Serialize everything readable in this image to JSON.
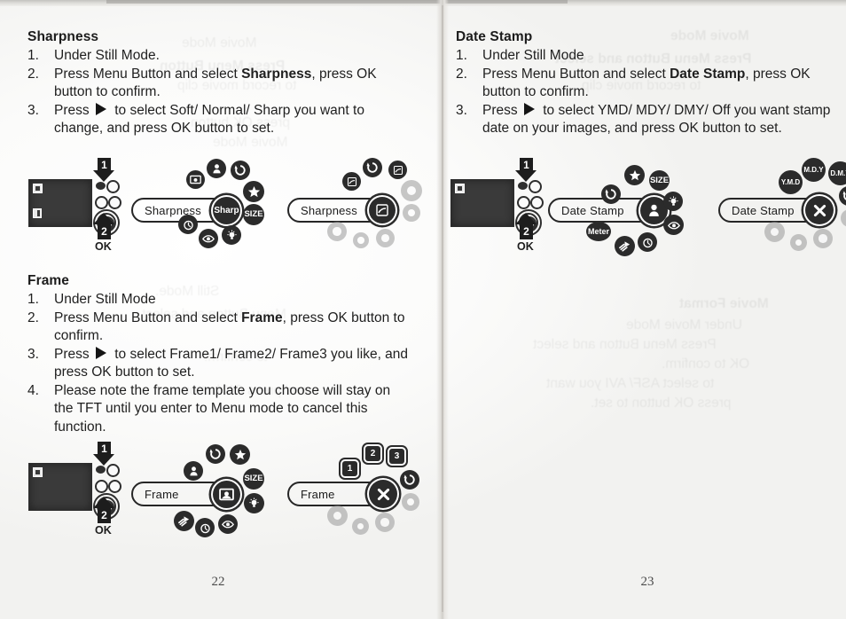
{
  "document": {
    "type": "camera-user-manual-spread",
    "scan_note": "two-page scanned spread with binding gutter and reverse-side show-through"
  },
  "left_page": {
    "page_number": "22",
    "sections": [
      {
        "id": "sharpness",
        "title": "Sharpness",
        "steps": [
          {
            "num": "1.",
            "parts": [
              {
                "t": "Under Still Mode."
              }
            ]
          },
          {
            "num": "2.",
            "parts": [
              {
                "t": "Press Menu Button and select "
              },
              {
                "t": "Sharpness",
                "bold": true
              },
              {
                "t": ", press OK button to confirm."
              }
            ]
          },
          {
            "num": "3.",
            "parts": [
              {
                "t": "Press "
              },
              {
                "t": "",
                "icon": "right-arrow"
              },
              {
                "t": " to select Soft/ Normal/ Sharp you want to change, and press OK button to set."
              }
            ]
          }
        ],
        "diagram": {
          "camera": {
            "shutter_callout": "1",
            "ok_callout": "2",
            "ok_label": "OK"
          },
          "menu_cluster": {
            "pill_label": "Sharpness",
            "selected_node": "Sharp",
            "orbit_icons": [
              "frame-icon",
              "stamp-icon",
              "rotate-icon",
              "star-icon",
              "size-icon",
              "lightbulb-icon",
              "redeye-icon",
              "timer-icon"
            ]
          },
          "value_cluster": {
            "pill_label": "Sharpness",
            "selected_node": "sharp-level-icon",
            "orbit_icons": [
              "rotate-icon",
              "sharp-level-icon",
              "sharp-level-icon"
            ],
            "dot_markers": 6
          }
        }
      },
      {
        "id": "frame",
        "title": "Frame",
        "steps": [
          {
            "num": "1.",
            "parts": [
              {
                "t": "Under Still Mode"
              }
            ]
          },
          {
            "num": "2.",
            "parts": [
              {
                "t": "Press Menu Button and select "
              },
              {
                "t": "Frame",
                "bold": true
              },
              {
                "t": ", press OK button to confirm."
              }
            ]
          },
          {
            "num": "3.",
            "parts": [
              {
                "t": "Press "
              },
              {
                "t": "",
                "icon": "right-arrow"
              },
              {
                "t": " to select Frame1/ Frame2/ Frame3 you like, and press OK button to set."
              }
            ]
          },
          {
            "num": "4.",
            "parts": [
              {
                "t": "Please note the frame template you choose will stay on the TFT until you enter to Menu mode to cancel this function."
              }
            ]
          }
        ],
        "diagram": {
          "camera": {
            "shutter_callout": "1",
            "ok_callout": "2",
            "ok_label": "OK"
          },
          "menu_cluster": {
            "pill_label": "Frame",
            "selected_node": "frame-icon",
            "orbit_icons": [
              "stamp-icon",
              "rotate-icon",
              "star-icon",
              "size-icon",
              "lightbulb-icon",
              "redeye-icon",
              "timer-icon",
              "flash-icon"
            ]
          },
          "value_cluster": {
            "pill_label": "Frame",
            "selected_node": "off-x-icon",
            "orbit_icons": [
              "1",
              "2",
              "3",
              "rotate-icon"
            ],
            "dot_markers": 5
          }
        }
      }
    ]
  },
  "right_page": {
    "page_number": "23",
    "sections": [
      {
        "id": "date-stamp",
        "title": "Date Stamp",
        "steps": [
          {
            "num": "1.",
            "parts": [
              {
                "t": "Under Still Mode"
              }
            ]
          },
          {
            "num": "2.",
            "parts": [
              {
                "t": "Press Menu Button and select "
              },
              {
                "t": "Date Stamp",
                "bold": true
              },
              {
                "t": ", press OK button to confirm."
              }
            ]
          },
          {
            "num": "3.",
            "parts": [
              {
                "t": "Press "
              },
              {
                "t": "",
                "icon": "right-arrow"
              },
              {
                "t": " to select YMD/ MDY/ DMY/ Off you want stamp date on your images, and press OK button to set."
              }
            ]
          }
        ],
        "diagram": {
          "camera": {
            "shutter_callout": "1",
            "ok_callout": "2",
            "ok_label": "OK"
          },
          "menu_cluster": {
            "pill_label": "Date Stamp",
            "selected_node": "stamp-icon",
            "orbit_icons": [
              "rotate-icon",
              "star-icon",
              "size-icon",
              "lightbulb-icon",
              "redeye-icon",
              "timer-icon",
              "flash-icon",
              "Meter"
            ]
          },
          "value_cluster": {
            "pill_label": "Date Stamp",
            "selected_node": "off-x-icon",
            "orbit_icons": [
              "Y.M.D",
              "M.D.Y",
              "D.M.Y",
              "rotate-icon"
            ],
            "dot_markers": 5
          }
        }
      }
    ]
  },
  "bleed_through": {
    "note": "faint mirrored show-through from the reverse page",
    "left_lines": [
      "Still Mode.",
      "Menu Button and select",
      "to confirm.",
      "to select",
      "and press OK button"
    ],
    "right_lines": [
      "Movie Format",
      "Under Movie Mode",
      "Press Menu Button and select",
      "OK to confirm.",
      "Press",
      "to select",
      "press OK button to set."
    ]
  }
}
